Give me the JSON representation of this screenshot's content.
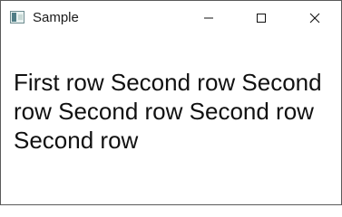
{
  "window": {
    "title": "Sample",
    "icon": "application-window-icon",
    "controls": {
      "minimize": "minimize-icon",
      "maximize": "maximize-icon",
      "close": "close-icon"
    }
  },
  "content": {
    "text": "First row Second row Second row Second row Second row Second row"
  },
  "colors": {
    "background": "#ffffff",
    "text": "#111111",
    "border": "#5a5a5a"
  }
}
